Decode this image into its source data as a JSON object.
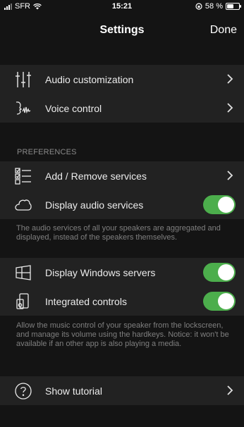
{
  "status_bar": {
    "carrier": "SFR",
    "time": "15:21",
    "battery_text": "58 %",
    "battery_level": 0.58
  },
  "nav": {
    "title": "Settings",
    "done_label": "Done"
  },
  "group1": {
    "items": [
      {
        "label": "Audio customization",
        "icon": "equalizer-sliders-icon"
      },
      {
        "label": "Voice control",
        "icon": "voice-wave-icon"
      }
    ]
  },
  "preferences": {
    "header": "PREFERENCES",
    "items": [
      {
        "label": "Add / Remove services",
        "icon": "checklist-icon"
      },
      {
        "label": "Display audio services",
        "icon": "cloud-icon",
        "toggle_on": true
      }
    ],
    "footnote": "The audio services of all your speakers are aggregated and displayed, instead of the speakers themselves."
  },
  "group3": {
    "items": [
      {
        "label": "Display Windows servers",
        "icon": "windows-icon",
        "toggle_on": true
      },
      {
        "label": "Integrated controls",
        "icon": "phone-speaker-icon",
        "toggle_on": true
      }
    ],
    "footnote": "Allow the music control of your speaker from the lockscreen, and manage its volume using the hardkeys. Notice: it won't be available if an other app is also playing a media."
  },
  "group4": {
    "items": [
      {
        "label": "Show tutorial",
        "icon": "question-circle-icon"
      }
    ]
  },
  "colors": {
    "background": "#141414",
    "row_background": "#222222",
    "toggle_on": "#4cae4c",
    "secondary_text": "#7f7f7f"
  }
}
